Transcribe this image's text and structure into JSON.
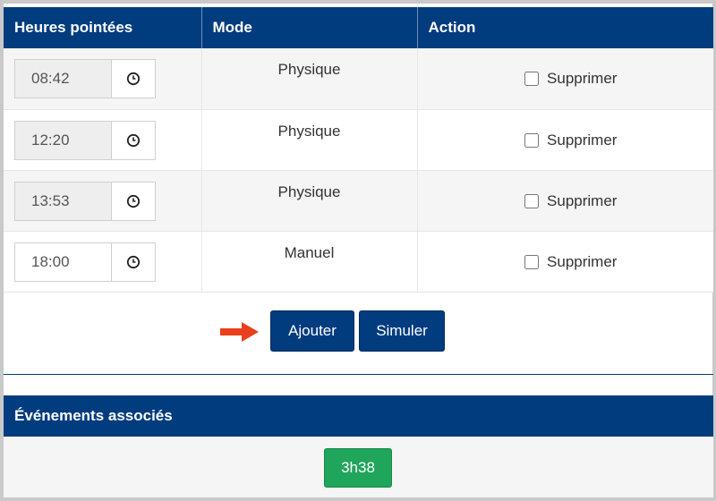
{
  "table": {
    "headers": [
      "Heures pointées",
      "Mode",
      "Action"
    ],
    "rows": [
      {
        "time": "08:42",
        "mode": "Physique",
        "action_label": "Supprimer"
      },
      {
        "time": "12:20",
        "mode": "Physique",
        "action_label": "Supprimer"
      },
      {
        "time": "13:53",
        "mode": "Physique",
        "action_label": "Supprimer"
      },
      {
        "time": "18:00",
        "mode": "Manuel",
        "action_label": "Supprimer"
      }
    ]
  },
  "buttons": {
    "add": "Ajouter",
    "simulate": "Simuler"
  },
  "events": {
    "title": "Événements associés",
    "badge": "3h38"
  },
  "colors": {
    "header": "#003c7e",
    "badge": "#20a55c",
    "arrow": "#e8401c"
  }
}
